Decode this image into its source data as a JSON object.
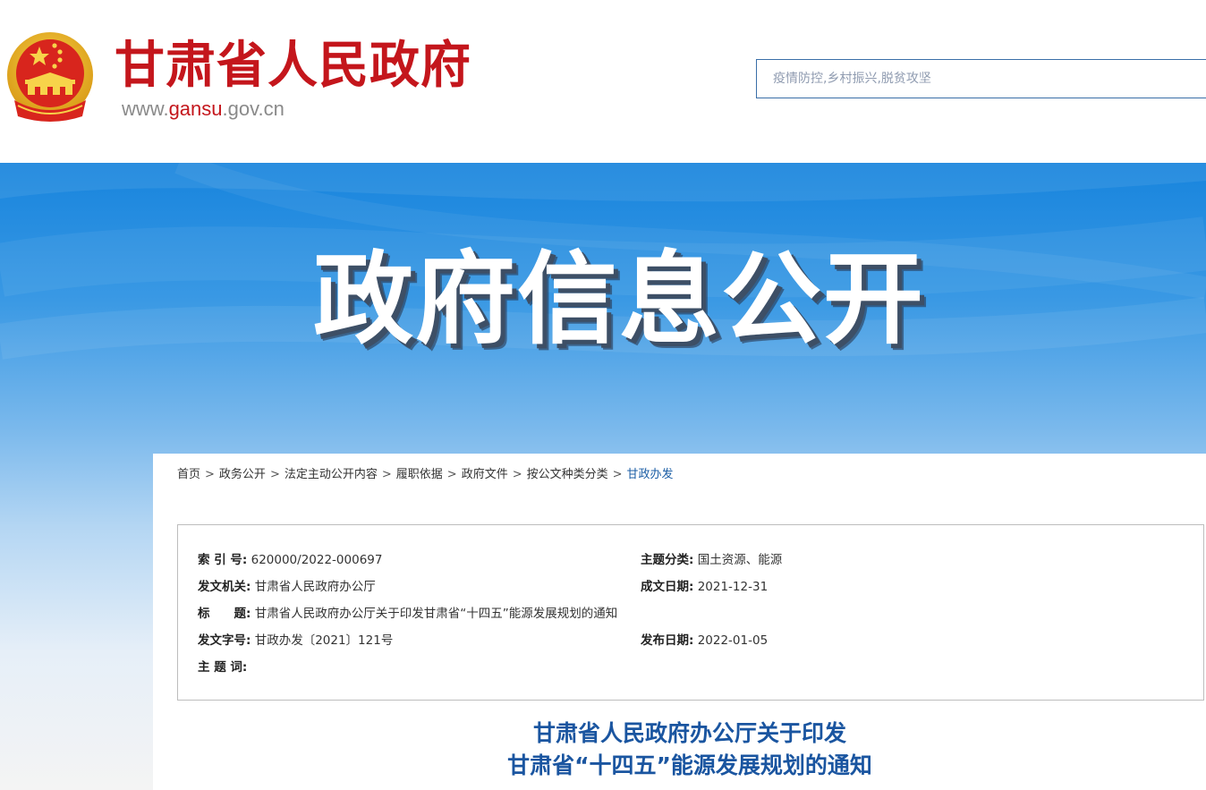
{
  "header": {
    "site_name": "甘肃省人民政府",
    "domain_prefix": "www.",
    "domain_highlight": "gansu",
    "domain_suffix": ".gov.cn",
    "search": {
      "placeholder": "疫情防控,乡村振兴,脱贫攻坚"
    }
  },
  "banner": {
    "title": "政府信息公开"
  },
  "breadcrumb": [
    {
      "label": "首页"
    },
    {
      "label": "政务公开"
    },
    {
      "label": "法定主动公开内容"
    },
    {
      "label": "履职依据"
    },
    {
      "label": "政府文件"
    },
    {
      "label": "按公文种类分类"
    },
    {
      "label": "甘政办发"
    }
  ],
  "breadcrumb_separator": ">",
  "meta": {
    "index_label": "索 引 号:",
    "index_value": "620000/2022-000697",
    "topic_label": "主题分类:",
    "topic_value": "国土资源、能源",
    "issuer_label": "发文机关:",
    "issuer_value": "甘肃省人民政府办公厅",
    "created_label": "成文日期:",
    "created_value": "2021-12-31",
    "title_label": "标　　题:",
    "title_value": "甘肃省人民政府办公厅关于印发甘肃省“十四五”能源发展规划的通知",
    "docno_label": "发文字号:",
    "docno_value": "甘政办发〔2021〕121号",
    "published_label": "发布日期:",
    "published_value": "2022-01-05",
    "keywords_label": "主 题 词:",
    "keywords_value": ""
  },
  "document": {
    "title_line1": "甘肃省人民政府办公厅关于印发",
    "title_line2": "甘肃省“十四五”能源发展规划的通知"
  },
  "colors": {
    "brand_red": "#c4161c",
    "link_blue": "#1d5fa6",
    "title_blue": "#1a55a0",
    "banner_blue": "#1784dd"
  }
}
